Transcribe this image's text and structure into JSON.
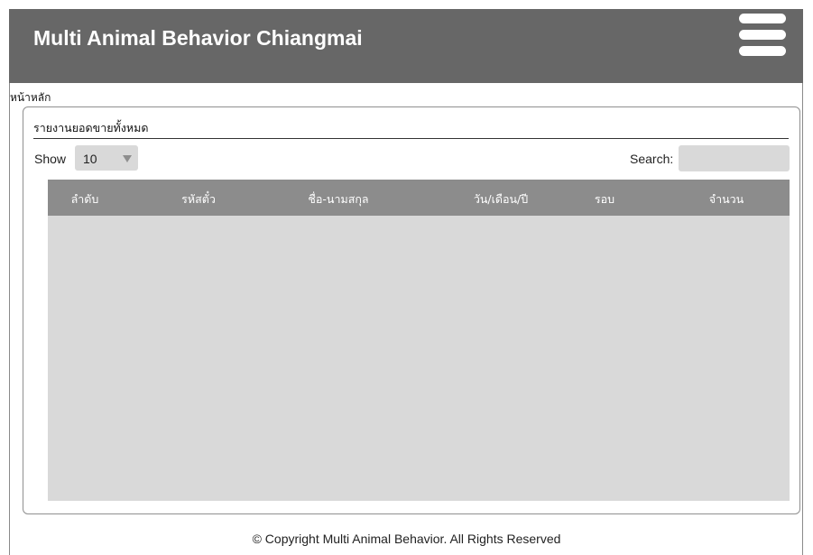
{
  "header": {
    "title": "Multi Animal Behavior Chiangmai",
    "menu_icon": "hamburger-menu-icon"
  },
  "breadcrumb": {
    "home": "หน้าหลัก"
  },
  "panel": {
    "title": "รายงานยอดขายทั้งหมด",
    "show_label": "Show",
    "show_value": "10",
    "search_label": "Search:",
    "search_value": "",
    "table": {
      "columns": [
        "ลำดับ",
        "รหัสตั๋ว",
        "ชื่อ-นามสกุล",
        "วัน/เดือน/ปี",
        "รอบ",
        "จำนวน"
      ],
      "rows": []
    }
  },
  "footer": {
    "copyright": "© Copyright Multi Animal Behavior. All Rights Reserved"
  },
  "colors": {
    "header_bg": "#676767",
    "table_header_bg": "#8c8c8c",
    "table_body_bg": "#d9d9d9",
    "input_bg": "#d9d9d9"
  }
}
